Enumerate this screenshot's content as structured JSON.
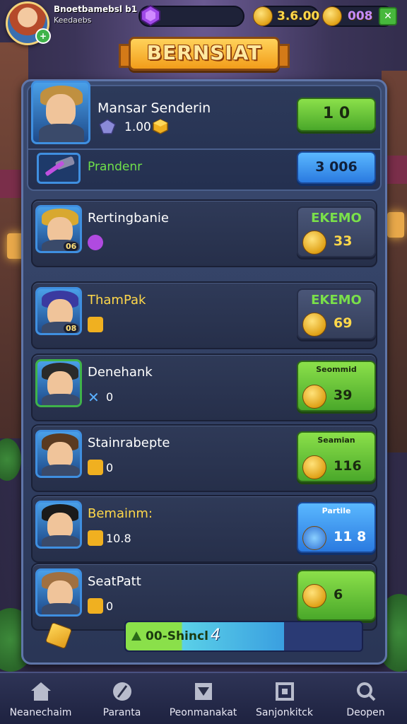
{
  "player": {
    "name": "Bnoetbamebsl b1",
    "subtitle": "Keedaebs",
    "level_badge": "+"
  },
  "currencies": {
    "coins": "3.6.00",
    "gems2": "008"
  },
  "banner": {
    "title": "BERNSIAT"
  },
  "header": {
    "hero_name": "Mansar Senderin",
    "hero_value": "1.00",
    "primary_button": "1 0",
    "weapon_label": "Prandenr",
    "secondary_button": "3 006"
  },
  "rows": [
    {
      "name": "Rertingbanie",
      "sub": "",
      "badge": "06",
      "button_top": "EKEMO",
      "button_value": "33",
      "button_style": "dark",
      "name_color": "#ffffff"
    },
    {
      "name": "ThamPak",
      "sub": "",
      "badge": "08",
      "button_top": "EKEMO",
      "button_value": "69",
      "button_style": "dark",
      "name_color": "#ffd84a"
    },
    {
      "name": "Denehank",
      "sub": "0",
      "badge": "",
      "button_top": "Seommid",
      "button_value": "39",
      "button_style": "green",
      "name_color": "#ffffff"
    },
    {
      "name": "Stainrabepte",
      "sub": "0",
      "badge": "",
      "button_top": "Seamian",
      "button_value": "116",
      "button_style": "green",
      "name_color": "#ffffff"
    },
    {
      "name": "Bemainm:",
      "sub": "10.8",
      "badge": "",
      "button_top": "Partile",
      "button_value": "11 8",
      "button_style": "blue",
      "name_color": "#ffd84a"
    },
    {
      "name": "SeatPatt",
      "sub": "0",
      "badge": "",
      "button_top": "",
      "button_value": "6",
      "button_style": "green",
      "name_color": "#ffffff"
    }
  ],
  "progress": {
    "label": "00-Shincl",
    "value": "4",
    "fraction": 0.67
  },
  "nav": [
    {
      "label": "Neanechaim",
      "icon": "home-icon"
    },
    {
      "label": "Paranta",
      "icon": "feather-icon"
    },
    {
      "label": "Peonmanakat",
      "icon": "shield-icon"
    },
    {
      "label": "Sanjonkitck",
      "icon": "frame-icon"
    },
    {
      "label": "Deopen",
      "icon": "search-icon"
    }
  ],
  "colors": {
    "accent_green": "#6fe04a",
    "accent_blue": "#3a9fe0",
    "gold": "#ffd84a",
    "panel": "#2f3a58"
  }
}
